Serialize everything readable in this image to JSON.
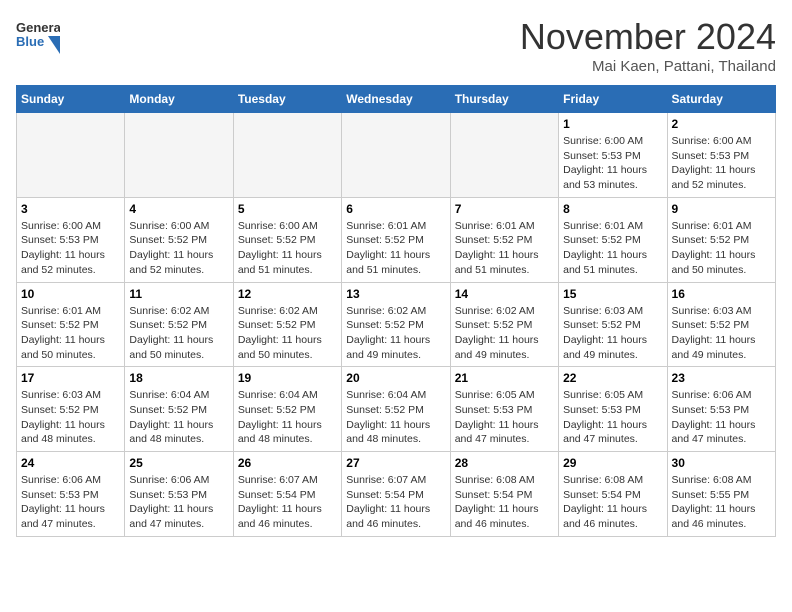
{
  "header": {
    "logo": {
      "general": "General",
      "blue": "Blue"
    },
    "title": "November 2024",
    "location": "Mai Kaen, Pattani, Thailand"
  },
  "calendar": {
    "weekdays": [
      "Sunday",
      "Monday",
      "Tuesday",
      "Wednesday",
      "Thursday",
      "Friday",
      "Saturday"
    ],
    "weeks": [
      [
        {
          "day": "",
          "info": ""
        },
        {
          "day": "",
          "info": ""
        },
        {
          "day": "",
          "info": ""
        },
        {
          "day": "",
          "info": ""
        },
        {
          "day": "",
          "info": ""
        },
        {
          "day": "1",
          "info": "Sunrise: 6:00 AM\nSunset: 5:53 PM\nDaylight: 11 hours and 53 minutes."
        },
        {
          "day": "2",
          "info": "Sunrise: 6:00 AM\nSunset: 5:53 PM\nDaylight: 11 hours and 52 minutes."
        }
      ],
      [
        {
          "day": "3",
          "info": "Sunrise: 6:00 AM\nSunset: 5:53 PM\nDaylight: 11 hours and 52 minutes."
        },
        {
          "day": "4",
          "info": "Sunrise: 6:00 AM\nSunset: 5:52 PM\nDaylight: 11 hours and 52 minutes."
        },
        {
          "day": "5",
          "info": "Sunrise: 6:00 AM\nSunset: 5:52 PM\nDaylight: 11 hours and 51 minutes."
        },
        {
          "day": "6",
          "info": "Sunrise: 6:01 AM\nSunset: 5:52 PM\nDaylight: 11 hours and 51 minutes."
        },
        {
          "day": "7",
          "info": "Sunrise: 6:01 AM\nSunset: 5:52 PM\nDaylight: 11 hours and 51 minutes."
        },
        {
          "day": "8",
          "info": "Sunrise: 6:01 AM\nSunset: 5:52 PM\nDaylight: 11 hours and 51 minutes."
        },
        {
          "day": "9",
          "info": "Sunrise: 6:01 AM\nSunset: 5:52 PM\nDaylight: 11 hours and 50 minutes."
        }
      ],
      [
        {
          "day": "10",
          "info": "Sunrise: 6:01 AM\nSunset: 5:52 PM\nDaylight: 11 hours and 50 minutes."
        },
        {
          "day": "11",
          "info": "Sunrise: 6:02 AM\nSunset: 5:52 PM\nDaylight: 11 hours and 50 minutes."
        },
        {
          "day": "12",
          "info": "Sunrise: 6:02 AM\nSunset: 5:52 PM\nDaylight: 11 hours and 50 minutes."
        },
        {
          "day": "13",
          "info": "Sunrise: 6:02 AM\nSunset: 5:52 PM\nDaylight: 11 hours and 49 minutes."
        },
        {
          "day": "14",
          "info": "Sunrise: 6:02 AM\nSunset: 5:52 PM\nDaylight: 11 hours and 49 minutes."
        },
        {
          "day": "15",
          "info": "Sunrise: 6:03 AM\nSunset: 5:52 PM\nDaylight: 11 hours and 49 minutes."
        },
        {
          "day": "16",
          "info": "Sunrise: 6:03 AM\nSunset: 5:52 PM\nDaylight: 11 hours and 49 minutes."
        }
      ],
      [
        {
          "day": "17",
          "info": "Sunrise: 6:03 AM\nSunset: 5:52 PM\nDaylight: 11 hours and 48 minutes."
        },
        {
          "day": "18",
          "info": "Sunrise: 6:04 AM\nSunset: 5:52 PM\nDaylight: 11 hours and 48 minutes."
        },
        {
          "day": "19",
          "info": "Sunrise: 6:04 AM\nSunset: 5:52 PM\nDaylight: 11 hours and 48 minutes."
        },
        {
          "day": "20",
          "info": "Sunrise: 6:04 AM\nSunset: 5:52 PM\nDaylight: 11 hours and 48 minutes."
        },
        {
          "day": "21",
          "info": "Sunrise: 6:05 AM\nSunset: 5:53 PM\nDaylight: 11 hours and 47 minutes."
        },
        {
          "day": "22",
          "info": "Sunrise: 6:05 AM\nSunset: 5:53 PM\nDaylight: 11 hours and 47 minutes."
        },
        {
          "day": "23",
          "info": "Sunrise: 6:06 AM\nSunset: 5:53 PM\nDaylight: 11 hours and 47 minutes."
        }
      ],
      [
        {
          "day": "24",
          "info": "Sunrise: 6:06 AM\nSunset: 5:53 PM\nDaylight: 11 hours and 47 minutes."
        },
        {
          "day": "25",
          "info": "Sunrise: 6:06 AM\nSunset: 5:53 PM\nDaylight: 11 hours and 47 minutes."
        },
        {
          "day": "26",
          "info": "Sunrise: 6:07 AM\nSunset: 5:54 PM\nDaylight: 11 hours and 46 minutes."
        },
        {
          "day": "27",
          "info": "Sunrise: 6:07 AM\nSunset: 5:54 PM\nDaylight: 11 hours and 46 minutes."
        },
        {
          "day": "28",
          "info": "Sunrise: 6:08 AM\nSunset: 5:54 PM\nDaylight: 11 hours and 46 minutes."
        },
        {
          "day": "29",
          "info": "Sunrise: 6:08 AM\nSunset: 5:54 PM\nDaylight: 11 hours and 46 minutes."
        },
        {
          "day": "30",
          "info": "Sunrise: 6:08 AM\nSunset: 5:55 PM\nDaylight: 11 hours and 46 minutes."
        }
      ]
    ]
  }
}
